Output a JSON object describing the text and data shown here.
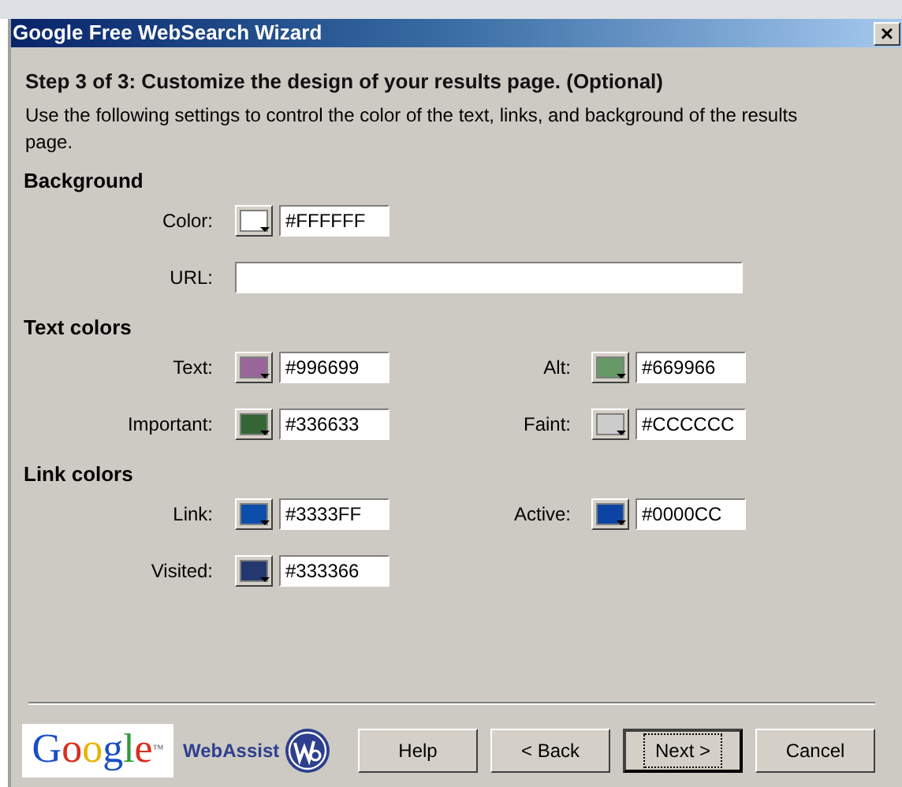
{
  "window": {
    "title": "Google Free WebSearch Wizard",
    "close": "×"
  },
  "step_title": "Step 3 of 3: Customize the design of your results page. (Optional)",
  "description": "Use the following settings to control the color of the text, links, and background of the results page.",
  "sections": [
    {
      "heading": "Background",
      "rows": [
        [
          {
            "kind": "color",
            "label": "Color:",
            "value": "#FFFFFF",
            "color": "#ffffff"
          }
        ],
        [
          {
            "kind": "text",
            "label": "URL:"
          }
        ]
      ]
    },
    {
      "heading": "Text colors",
      "rows": [
        [
          {
            "kind": "color",
            "label": "Text:",
            "value": "#996699",
            "color": "#996699"
          },
          {
            "kind": "color",
            "label": "Alt:",
            "value": "#669966",
            "color": "#669966"
          }
        ],
        [
          {
            "kind": "color",
            "label": "Important:",
            "value": "#336633",
            "color": "#336633"
          },
          {
            "kind": "color",
            "label": "Faint:",
            "value": "#CCCCCC",
            "color": "#cccccc"
          }
        ]
      ]
    },
    {
      "heading": "Link colors",
      "rows": [
        [
          {
            "kind": "color",
            "label": "Link:",
            "value": "#3333FF",
            "color": "#0c4eaa"
          },
          {
            "kind": "color",
            "label": "Active:",
            "value": "#0000CC",
            "color": "#0c44a4"
          }
        ],
        [
          {
            "kind": "color",
            "label": "Visited:",
            "value": "#333366",
            "color": "#23386e"
          }
        ]
      ]
    }
  ],
  "footer": {
    "google_logo": {
      "word": "Google",
      "mark": "™"
    },
    "webassist_logo": "WebAssist",
    "buttons": [
      {
        "label": "Help",
        "default": false
      },
      {
        "label": "< Back",
        "default": false
      },
      {
        "label": "Next >",
        "default": true
      },
      {
        "label": "Cancel",
        "default": false
      }
    ]
  }
}
